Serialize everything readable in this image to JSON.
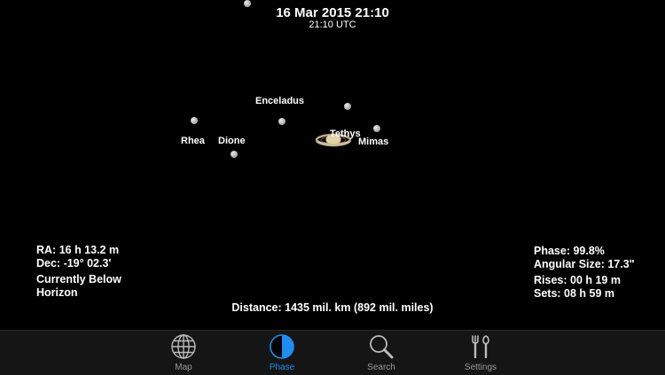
{
  "datetime": {
    "local": "16 Mar 2015 21:10",
    "utc": "21:10 UTC"
  },
  "moons": [
    {
      "label": "Enceladus"
    },
    {
      "label": "Tethys"
    },
    {
      "label": "Mimas"
    },
    {
      "label": "Rhea"
    },
    {
      "label": "Dione"
    }
  ],
  "info": {
    "ra": "RA: 16 h 13.2 m",
    "dec": "Dec: -19° 02.3'",
    "visibility_line1": "Currently Below",
    "visibility_line2": "Horizon",
    "phase": "Phase: 99.8%",
    "angular_size": "Angular Size: 17.3\"",
    "rises": "Rises: 00 h 19 m",
    "sets": "Sets: 08 h 59 m",
    "distance": "Distance: 1435 mil. km (892 mil. miles)"
  },
  "tabs": [
    {
      "label": "Map",
      "icon": "globe-icon",
      "active": false
    },
    {
      "label": "Phase",
      "icon": "phase-icon",
      "active": true
    },
    {
      "label": "Search",
      "icon": "magnifier-icon",
      "active": false
    },
    {
      "label": "Settings",
      "icon": "tools-icon",
      "active": false
    }
  ],
  "colors": {
    "accent": "#1e8cf0",
    "background": "#000000",
    "tabbar": "#151515"
  }
}
